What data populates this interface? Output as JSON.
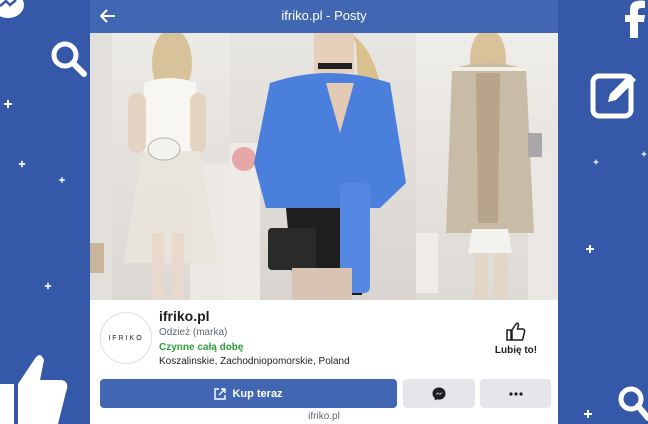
{
  "header": {
    "title": "ifriko.pl - Posty"
  },
  "page": {
    "name": "ifriko.pl",
    "category": "Odzież (marka)",
    "hours": "Czynne całą dobę",
    "location": "Koszalinskie, Zachodniopomorskie, Poland",
    "avatar_text": "IFRIKO",
    "like_label": "Lubię to!"
  },
  "actions": {
    "buy_label": "Kup teraz"
  },
  "footer": {
    "url": "ifriko.pl"
  },
  "colors": {
    "facebook_blue": "#4267b2",
    "open_green": "#2e9e3f",
    "background": "#3b5998"
  },
  "icons": [
    "back-arrow-icon",
    "thumbs-up-icon",
    "external-link-icon",
    "messenger-icon",
    "more-dots-icon"
  ]
}
